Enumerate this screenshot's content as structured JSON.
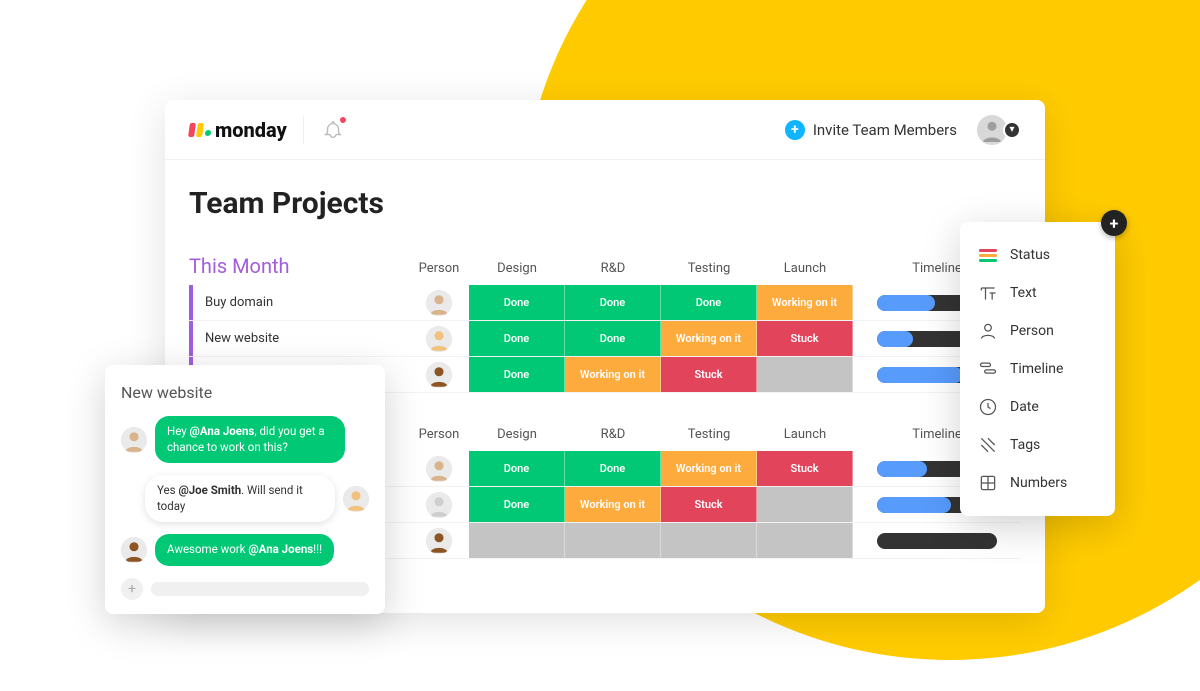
{
  "brand": {
    "name": "monday"
  },
  "topbar": {
    "invite_label": "Invite Team Members"
  },
  "page": {
    "title": "Team Projects"
  },
  "groups": [
    {
      "title": "This Month",
      "columns": [
        "Person",
        "Design",
        "R&D",
        "Testing",
        "Launch",
        "Timeline"
      ],
      "rows": [
        {
          "name": "Buy domain",
          "person": 1,
          "cells": [
            "Done",
            "Done",
            "Done",
            "Working on it"
          ],
          "timeline_pct": 48
        },
        {
          "name": "New website",
          "person": 2,
          "cells": [
            "Done",
            "Done",
            "Working on it",
            "Stuck"
          ],
          "timeline_pct": 30
        },
        {
          "name": "",
          "person": 3,
          "cells": [
            "Done",
            "Working on it",
            "Stuck",
            ""
          ],
          "timeline_pct": 72
        }
      ]
    },
    {
      "title": "",
      "columns": [
        "Person",
        "Design",
        "R&D",
        "Testing",
        "Launch",
        "Timeline"
      ],
      "rows": [
        {
          "name": "",
          "person": 1,
          "cells": [
            "Done",
            "Done",
            "Working on it",
            "Stuck"
          ],
          "timeline_pct": 42
        },
        {
          "name": "",
          "person": 0,
          "cells": [
            "Done",
            "Working on it",
            "Stuck",
            ""
          ],
          "timeline_pct": 62
        },
        {
          "name": "",
          "person": 3,
          "cells": [
            "",
            "",
            "",
            ""
          ],
          "timeline_pct": 0
        }
      ]
    }
  ],
  "chat": {
    "title": "New website",
    "messages": [
      {
        "side": "left",
        "bubble": "green",
        "text_pre": "Hey ",
        "mention": "@Ana Joens",
        "text_post": ", did you get a chance to work on this?"
      },
      {
        "side": "right",
        "bubble": "white",
        "text_pre": "Yes ",
        "mention": "@Joe Smith",
        "text_post": ". Will send it today"
      },
      {
        "side": "left",
        "bubble": "green",
        "text_pre": "Awesome work ",
        "mention": "@Ana Joens",
        "text_post": "!!!"
      }
    ]
  },
  "column_types": [
    {
      "key": "status",
      "label": "Status"
    },
    {
      "key": "text",
      "label": "Text"
    },
    {
      "key": "person",
      "label": "Person"
    },
    {
      "key": "timeline",
      "label": "Timeline"
    },
    {
      "key": "date",
      "label": "Date"
    },
    {
      "key": "tags",
      "label": "Tags"
    },
    {
      "key": "numbers",
      "label": "Numbers"
    }
  ],
  "status_labels": {
    "Done": "Done",
    "Working on it": "Working on it",
    "Stuck": "Stuck"
  }
}
